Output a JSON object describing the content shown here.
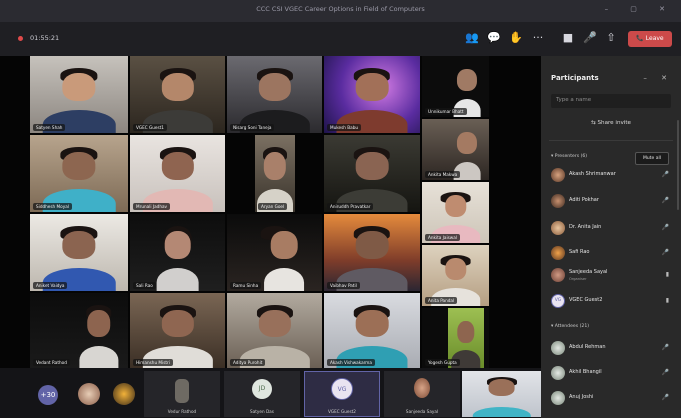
{
  "window": {
    "title": "CCC CSI VGEC Career Options in Field of Computers"
  },
  "toolbar": {
    "timer": "01:55:21",
    "leave_label": "Leave"
  },
  "colors": {
    "accent": "#6264a7",
    "leave": "#cc4a4a",
    "recording": "#e04a4a"
  },
  "icons": [
    "participants-icon",
    "chat-icon",
    "raise-hand-icon",
    "more-icon",
    "camera-icon",
    "mic-icon",
    "share-icon"
  ],
  "tiles": [
    {
      "name": "Satyen Shah"
    },
    {
      "name": "VGEC Guest1"
    },
    {
      "name": "Nisarg Soni Taneja"
    },
    {
      "name": "Mukesh Babu"
    },
    {
      "name": "Unnikumar Bhatt"
    },
    {
      "name": "Siddhesh Moyal"
    },
    {
      "name": "Mrunali Jadhav"
    },
    {
      "name": "Aryan Goel"
    },
    {
      "name": "Aniruddh Pravatkar"
    },
    {
      "name": "Ankita Makwa"
    },
    {
      "name": "Aniket Vaidya"
    },
    {
      "name": "Sali Rao"
    },
    {
      "name": "Ramu Sinha"
    },
    {
      "name": "Vaibhav Patil"
    },
    {
      "name": "Ankita Jaiswal"
    },
    {
      "name": "Anita Pandal"
    },
    {
      "name": "Vedant Rathod"
    },
    {
      "name": "Himanshu Mistri"
    },
    {
      "name": "Aditya Purohit"
    },
    {
      "name": "Akash Vishwakarma"
    },
    {
      "name": "Yogesh Gupta"
    }
  ],
  "bottom_strip": {
    "more_count": "+30",
    "captions": [
      "Vedur Rathod",
      "Satyen Das",
      "VGEC Guest2",
      "Sanjeeda Sayal"
    ],
    "initials": [
      "JD",
      "VG"
    ]
  },
  "panel": {
    "title": "Participants",
    "search_placeholder": "Type a name",
    "share_label": "Share invite",
    "presenters_label": "Presenters (6)",
    "mute_all_label": "Mute all",
    "attendees_label": "Attendees (21)",
    "presenters": [
      {
        "name": "Akash Shrimanwar"
      },
      {
        "name": "Aditi Pokhar"
      },
      {
        "name": "Dr. Anita Jain"
      },
      {
        "name": "Safi Rao"
      },
      {
        "name": "Sanjeeda Sayal",
        "sub": "Organiser"
      },
      {
        "name": "VGEC Guest2"
      }
    ],
    "attendees": [
      {
        "name": "Abdul Rehman"
      },
      {
        "name": "Akhil Bhangil"
      },
      {
        "name": "Anuj Joshi"
      }
    ]
  }
}
